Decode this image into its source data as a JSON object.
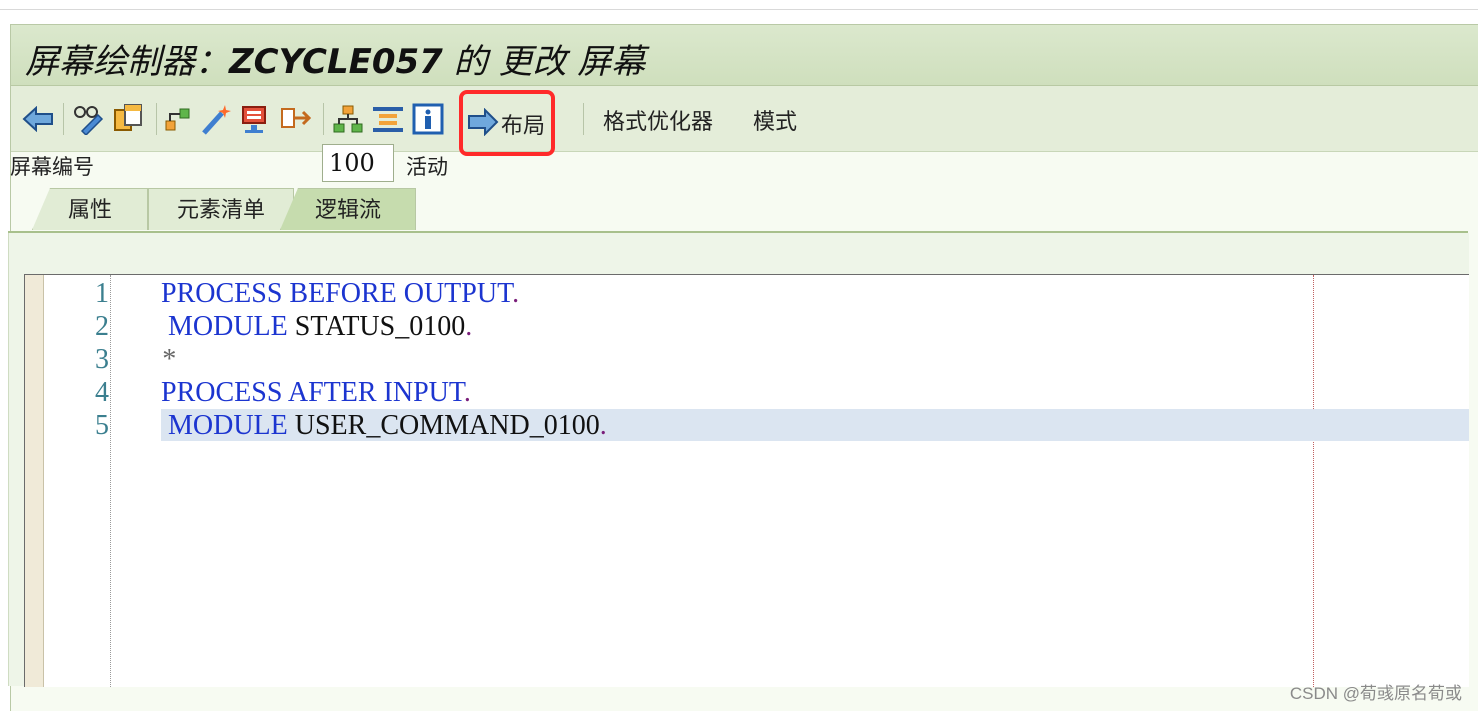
{
  "window": {
    "title_prefix": "屏幕绘制器：",
    "title_program": "ZCYCLE057",
    "title_suffix": " 的 更改 屏幕"
  },
  "toolbar": {
    "icons": [
      "back-icon",
      "display-change-icon",
      "copy-icon",
      "hierarchy-icon",
      "wand-icon",
      "screen-icon",
      "transfer-icon",
      "org-icon",
      "list-icon",
      "info-icon"
    ],
    "layout_label": "布局",
    "format_label": "格式优化器",
    "mode_label": "模式",
    "highlight_color": "#ff2a2a"
  },
  "screen": {
    "number_label": "屏幕编号",
    "number_value": "100",
    "status": "活动"
  },
  "tabs": [
    {
      "label": "属性",
      "active": false
    },
    {
      "label": "元素清单",
      "active": false
    },
    {
      "label": "逻辑流",
      "active": true
    }
  ],
  "editor": {
    "lines": [
      {
        "num": "1",
        "kw1": "PROCESS BEFORE OUTPUT",
        "rest": "",
        "end": "."
      },
      {
        "num": "2",
        "kw1": " MODULE",
        "rest": " STATUS_0100",
        "end": "."
      },
      {
        "num": "3",
        "comment": "*"
      },
      {
        "num": "4",
        "kw1": "PROCESS AFTER INPUT",
        "rest": "",
        "end": "."
      },
      {
        "num": "5",
        "kw1": " MODULE",
        "rest": " USER_COMMAND_0100",
        "end": "."
      }
    ],
    "current_line": 5
  },
  "watermark": "CSDN @荀彧原名荀或"
}
